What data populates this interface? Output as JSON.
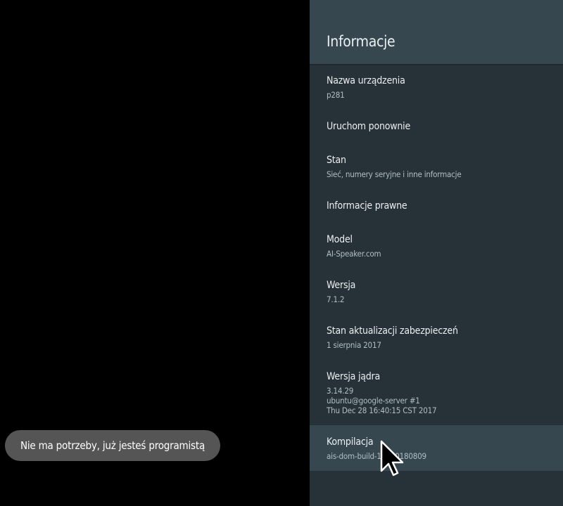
{
  "panel": {
    "title": "Informacje",
    "items": [
      {
        "title": "Nazwa urządzenia",
        "summary": "p281"
      },
      {
        "title": "Uruchom ponownie"
      },
      {
        "title": "Stan",
        "summary": "Sieć, numery seryjne i inne informacje"
      },
      {
        "title": "Informacje prawne"
      },
      {
        "title": "Model",
        "summary": "AI-Speaker.com"
      },
      {
        "title": "Wersja",
        "summary": "7.1.2"
      },
      {
        "title": "Stan aktualizacji zabezpieczeń",
        "summary": "1 sierpnia 2017"
      },
      {
        "title": "Wersja jądra",
        "summary": "3.14.29\nubuntu@google-server #1\nThu Dec 28 16:40:15 CST 2017"
      },
      {
        "title": "Kompilacja",
        "summary": "ais-dom-build-1.0-20180809",
        "selected": true
      }
    ]
  },
  "toast": {
    "text": "Nie ma potrzeby, już jesteś programistą"
  },
  "colors": {
    "panel_bg": "#263238",
    "header_bg": "#37474f",
    "selected_bg": "#37474f",
    "toast_bg": "#555555"
  },
  "icons": {
    "cursor": "mouse-pointer-icon"
  }
}
